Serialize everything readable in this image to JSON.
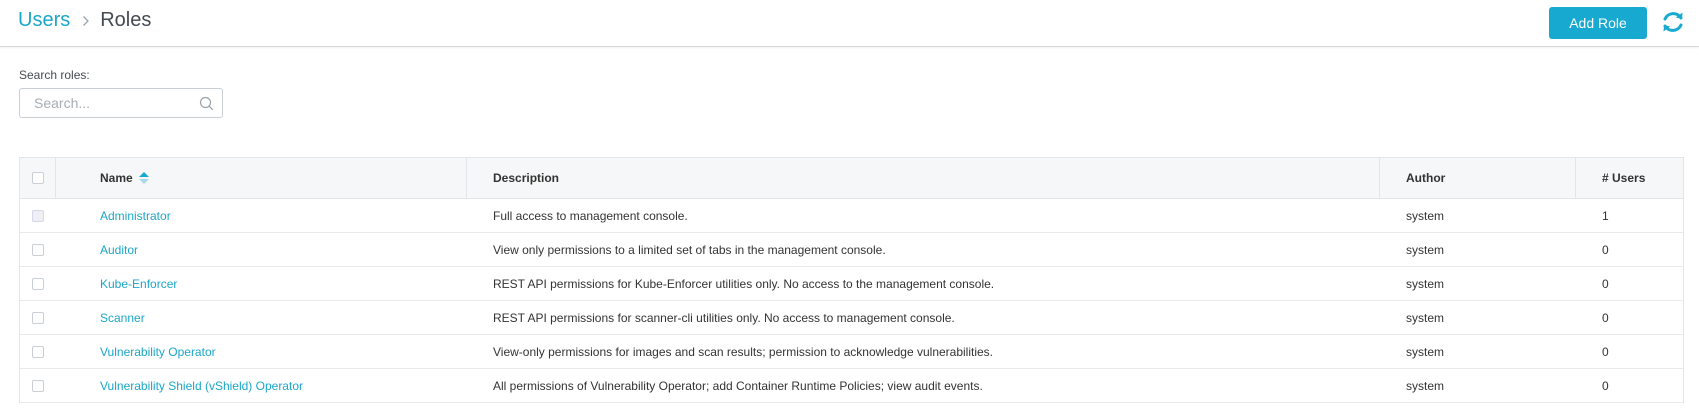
{
  "breadcrumb": {
    "parent": "Users",
    "current": "Roles"
  },
  "header": {
    "add_role_label": "Add Role",
    "refresh_icon": "refresh-icon"
  },
  "search": {
    "label": "Search roles:",
    "placeholder": "Search...",
    "value": "",
    "icon": "search-icon"
  },
  "colors": {
    "accent": "#17a9d0",
    "link": "#1ba7c9"
  },
  "table": {
    "columns": {
      "name": "Name",
      "description": "Description",
      "author": "Author",
      "users": "# Users"
    },
    "sort": {
      "column": "name",
      "direction": "ascending"
    },
    "rows": [
      {
        "name": "Administrator",
        "description": "Full access to management console.",
        "author": "system",
        "users": "1"
      },
      {
        "name": "Auditor",
        "description": "View only permissions to a limited set of tabs in the management console.",
        "author": "system",
        "users": "0"
      },
      {
        "name": "Kube-Enforcer",
        "description": "REST API permissions for Kube-Enforcer utilities only. No access to the management console.",
        "author": "system",
        "users": "0"
      },
      {
        "name": "Scanner",
        "description": "REST API permissions for scanner-cli utilities only. No access to management console.",
        "author": "system",
        "users": "0"
      },
      {
        "name": "Vulnerability Operator",
        "description": "View-only permissions for images and scan results; permission to acknowledge vulnerabilities.",
        "author": "system",
        "users": "0"
      },
      {
        "name": "Vulnerability Shield (vShield) Operator",
        "description": "All permissions of Vulnerability Operator; add Container Runtime Policies; view audit events.",
        "author": "system",
        "users": "0"
      }
    ]
  }
}
